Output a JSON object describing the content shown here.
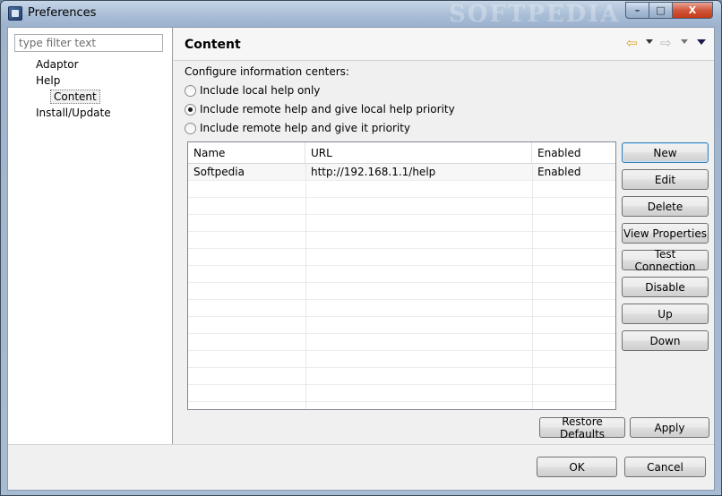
{
  "window": {
    "title": "Preferences",
    "watermark": "SOFTPEDIA",
    "minimize": "–",
    "maximize": "□",
    "close": "X"
  },
  "sidebar": {
    "filter_placeholder": "type filter text",
    "items": [
      {
        "label": "Adaptor"
      },
      {
        "label": "Help"
      },
      {
        "label": "Content"
      },
      {
        "label": "Install/Update"
      }
    ]
  },
  "page": {
    "title": "Content",
    "back_icon": "⇦",
    "forward_icon": "⇨",
    "section_label": "Configure information centers:",
    "options": [
      {
        "label": "Include local help only",
        "checked": false
      },
      {
        "label": "Include remote help and give local help priority",
        "checked": true
      },
      {
        "label": "Include remote help and give it priority",
        "checked": false
      }
    ]
  },
  "table": {
    "columns": [
      "Name",
      "URL",
      "Enabled"
    ],
    "rows": [
      {
        "name": "Softpedia",
        "url": "http://192.168.1.1/help",
        "enabled": "Enabled"
      }
    ]
  },
  "buttons": {
    "new": "New",
    "edit": "Edit",
    "delete": "Delete",
    "view_properties": "View Properties",
    "test_connection": "Test Connection",
    "disable": "Disable",
    "up": "Up",
    "down": "Down",
    "restore_defaults": "Restore Defaults",
    "apply": "Apply",
    "ok": "OK",
    "cancel": "Cancel"
  }
}
